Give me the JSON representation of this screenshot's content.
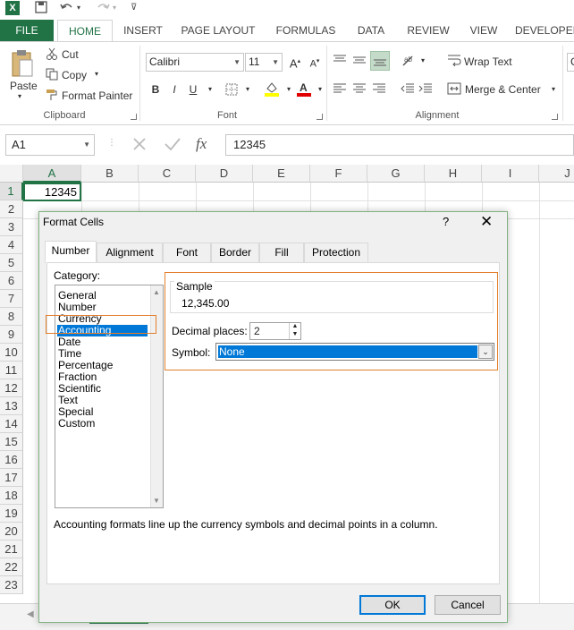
{
  "qat": {
    "logo": "X",
    "save_icon": "save-icon",
    "undo_icon": "undo-icon",
    "redo_icon": "redo-icon"
  },
  "tabs": {
    "file": "FILE",
    "items": [
      "HOME",
      "INSERT",
      "PAGE LAYOUT",
      "FORMULAS",
      "DATA",
      "REVIEW",
      "VIEW",
      "DEVELOPER"
    ]
  },
  "ribbon": {
    "clipboard": {
      "paste": "Paste",
      "cut": "Cut",
      "copy": "Copy",
      "format_painter": "Format Painter",
      "label": "Clipboard"
    },
    "font": {
      "name": "Calibri",
      "size": "11",
      "bold": "B",
      "italic": "I",
      "underline": "U",
      "label": "Font"
    },
    "alignment": {
      "wrap_text": "Wrap Text",
      "merge_center": "Merge & Center",
      "label": "Alignment"
    },
    "next_group_partial": "G"
  },
  "formula_bar": {
    "name_box": "A1",
    "fx": "fx",
    "value": "12345"
  },
  "sheet": {
    "columns": [
      "A",
      "B",
      "C",
      "D",
      "E",
      "F",
      "G",
      "H",
      "I",
      "J"
    ],
    "rows": [
      "1",
      "2",
      "3",
      "4",
      "5",
      "6",
      "7",
      "8",
      "9",
      "10",
      "11",
      "12",
      "13",
      "14",
      "15",
      "16",
      "17",
      "18",
      "19",
      "20",
      "21",
      "22",
      "23"
    ],
    "a1_value": "12345"
  },
  "dialog": {
    "title": "Format Cells",
    "help": "?",
    "close": "✕",
    "tabs": [
      "Number",
      "Alignment",
      "Font",
      "Border",
      "Fill",
      "Protection"
    ],
    "category_label": "Category:",
    "categories": [
      "General",
      "Number",
      "Currency",
      "Accounting",
      "Date",
      "Time",
      "Percentage",
      "Fraction",
      "Scientific",
      "Text",
      "Special",
      "Custom"
    ],
    "selected_category": "Accounting",
    "sample_label": "Sample",
    "sample_value": "12,345.00",
    "decimal_label": "Decimal places:",
    "decimal_value": "2",
    "symbol_label": "Symbol:",
    "symbol_value": "None",
    "description": "Accounting formats line up the currency symbols and decimal points in a column.",
    "ok": "OK",
    "cancel": "Cancel"
  },
  "colors": {
    "excel_green": "#217346",
    "selection_blue": "#0078d7",
    "highlight_orange": "#e27f2d"
  }
}
